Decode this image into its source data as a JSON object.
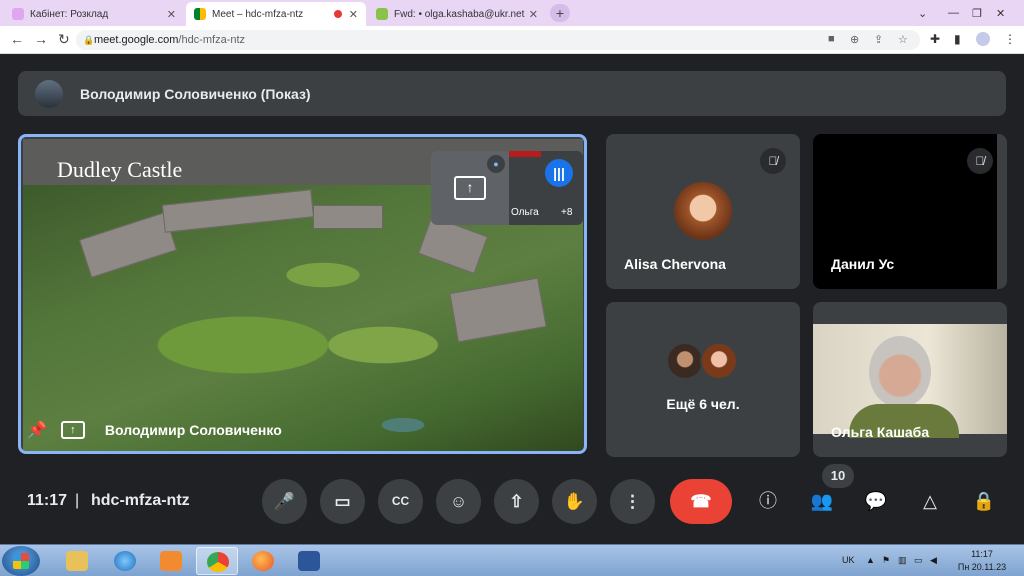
{
  "browser": {
    "tabs": [
      {
        "label": "Кабінет: Розклад",
        "active": false
      },
      {
        "label": "Meet – hdc-mfza-ntz",
        "active": true
      },
      {
        "label": "Fwd: • olga.kashaba@ukr.net",
        "active": false
      }
    ],
    "url_host": "meet.google.com",
    "url_path": "/hdc-mfza-ntz"
  },
  "meet": {
    "presenter_bar_text": "Володимир Соловиченко (Показ)",
    "main": {
      "slide_title": "Dudley Castle",
      "presenter_name": "Володимир Соловиченко",
      "mini_name": "Ольга",
      "mini_plus": "+8"
    },
    "tiles": [
      {
        "name": "Alisa Chervona"
      },
      {
        "name": "Данил Ус"
      },
      {
        "name": "Ещё 6 чел."
      },
      {
        "name": "Ольга Кашаба"
      }
    ],
    "participant_count": "10",
    "time": "11:17",
    "separator": "|",
    "meeting_code": "hdc-mfza-ntz"
  },
  "taskbar": {
    "lang": "UK",
    "clock_time": "11:17",
    "clock_date": "Пн 20.11.23"
  },
  "colors": {
    "meet_bg": "#202124",
    "tile_bg": "#3c4043",
    "active_border": "#8ab4f8",
    "end_call": "#ea4335",
    "speaking": "#1a73e8"
  }
}
